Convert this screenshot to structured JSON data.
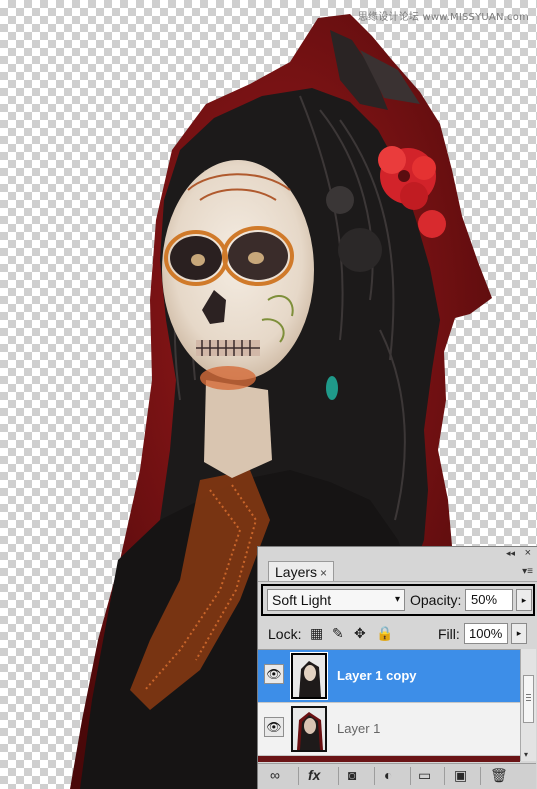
{
  "watermark": "思缘设计论坛 www.MISSYUAN.com",
  "panel": {
    "tab_label": "Layers",
    "tab_close": "×",
    "close_glyph": "×",
    "collapse_glyph": "◂◂",
    "menu_glyph": "▾≡",
    "blend_mode": "Soft Light",
    "opacity_label": "Opacity:",
    "opacity_value": "50%",
    "lock_label": "Lock:",
    "fill_label": "Fill:",
    "fill_value": "100%",
    "layers": [
      {
        "name": "Layer 1 copy",
        "visible": true,
        "selected": true
      },
      {
        "name": "Layer 1",
        "visible": true,
        "selected": false
      }
    ]
  },
  "icons": {
    "eye": "👁",
    "dropdown": "▾",
    "stepper": "▸",
    "lock_transparent": "▦",
    "lock_paint": "✎",
    "lock_move": "✥",
    "lock_all": "🔒",
    "link": "∞",
    "fx": "fx",
    "mask": "◙",
    "adjustment": "◐",
    "group": "▭",
    "new_layer": "▣",
    "delete": "🗑",
    "scroll_down": "▾"
  },
  "colors": {
    "selected_layer": "#3d8ee8",
    "panel_bg": "#d6d6d6",
    "checker": "#cfcfcf",
    "backdrop_red": "#7a1214"
  }
}
